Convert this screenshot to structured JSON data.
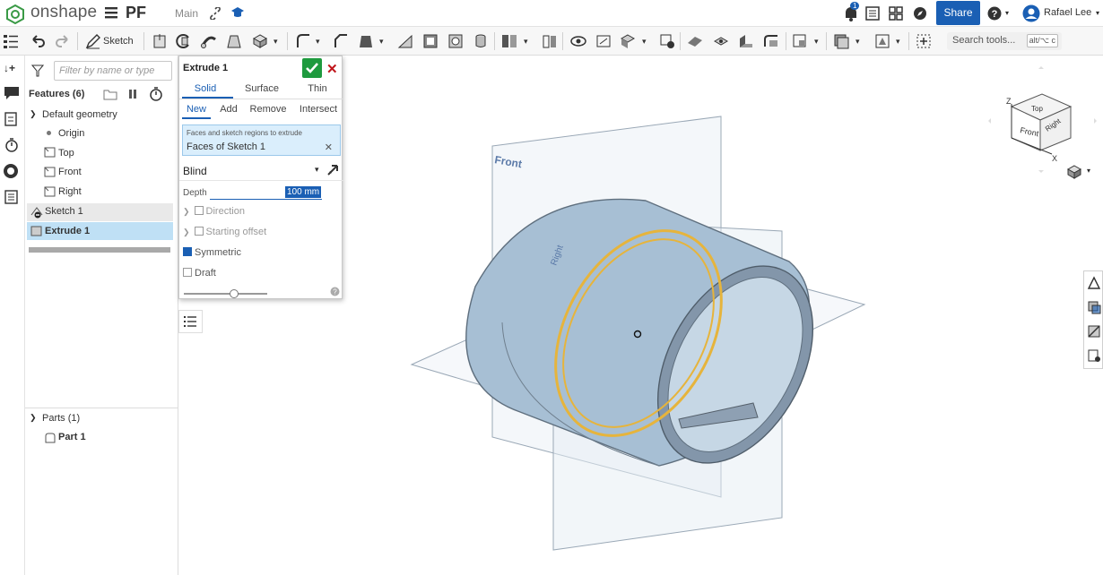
{
  "app": {
    "logo_text": "onshape",
    "doc_title": "PF",
    "branch": "Main"
  },
  "header": {
    "notification_count": "1",
    "share_label": "Share",
    "user_name": "Rafael Lee"
  },
  "toolbar": {
    "sketch_label": "Sketch",
    "search_placeholder": "Search tools...",
    "search_shortcut": "alt/⌥ c"
  },
  "features": {
    "filter_placeholder": "Filter by name or type",
    "heading": "Features (6)",
    "default_geometry": "Default geometry",
    "origin": "Origin",
    "top": "Top",
    "front": "Front",
    "right": "Right",
    "sketch1": "Sketch 1",
    "extrude1": "Extrude 1",
    "parts_heading": "Parts (1)",
    "part1": "Part 1"
  },
  "dialog": {
    "title": "Extrude 1",
    "body_tabs": [
      "Solid",
      "Surface",
      "Thin"
    ],
    "op_tabs": [
      "New",
      "Add",
      "Remove",
      "Intersect"
    ],
    "faces_hint": "Faces and sketch regions to extrude",
    "faces_value": "Faces of Sketch 1",
    "end_type": "Blind",
    "depth_label": "Depth",
    "depth_value": "100 mm",
    "direction_label": "Direction",
    "starting_offset_label": "Starting offset",
    "symmetric_label": "Symmetric",
    "symmetric_checked": true,
    "draft_label": "Draft",
    "draft_checked": false,
    "slider_level": 0.6
  },
  "viewport": {
    "front_plane_label": "Front",
    "right_plane_label": "Right",
    "view_cube": {
      "top": "Top",
      "front": "Front",
      "right": "Right",
      "axis_x": "X",
      "axis_z": "Z"
    }
  },
  "colors": {
    "accent": "#1a5fb4",
    "confirm": "#1e9a3e",
    "cancel": "#c0151b",
    "part_fill": "#a7bfd4",
    "selection": "#e6b43c"
  }
}
